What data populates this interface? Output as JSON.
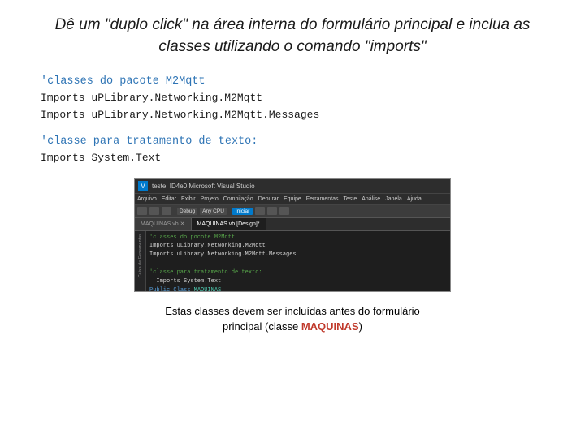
{
  "title": "Dê um \"duplo click\" na área interna do formulário principal e inclua as classes utilizando o comando \"imports\"",
  "sections": [
    {
      "id": "section1",
      "title": "'classes do pacote M2Mqtt",
      "lines": [
        "Imports uPLibrary.Networking.M2Mqtt",
        "Imports uPLibrary.Networking.M2Mqtt.Messages"
      ]
    },
    {
      "id": "section2",
      "title": "'classe para tratamento de texto:",
      "lines": [
        "Imports System.Text"
      ]
    }
  ],
  "vs_window": {
    "title": "teste: ID4e0  Microsoft Visual Studio",
    "menu_items": [
      "Arquivo",
      "Editar",
      "Exibir",
      "Projeto",
      "Compilação",
      "Depurar",
      "Equipe",
      "Ferramentas",
      "Teste",
      "Análise",
      "Janela",
      "Ajuda"
    ],
    "toolbar_debug": "Debug",
    "toolbar_cpu": "Any CPU",
    "toolbar_start": "Iniciar",
    "tabs": [
      {
        "label": "MAQUINAS.vb ✕",
        "active": false
      },
      {
        "label": "MAQUINAS.vb [Design]*",
        "active": true
      }
    ],
    "sidebar_label": "Caixa de Ferramentas",
    "code_lines": [
      {
        "num": "",
        "text": "'classes do pocote M2Mqtt",
        "style": "green"
      },
      {
        "num": "",
        "text": "Imports uLibrary.Networking.M2Mqtt",
        "style": "white"
      },
      {
        "num": "",
        "text": "Imports uLibrary.Networking.M2Mqtt.Messages",
        "style": "white"
      },
      {
        "num": "",
        "text": "",
        "style": "white"
      },
      {
        "num": "",
        "text": "'classe para tratamento de texto:",
        "style": "green"
      },
      {
        "num": "",
        "text": "  Imports System.Text",
        "style": "white"
      },
      {
        "num": "",
        "text": "Public Class MAQUINAS",
        "style": "blue"
      }
    ]
  },
  "bottom_note": {
    "line1": "Estas classes devem ser incluídas antes do formulário",
    "line2_plain": "principal (classe ",
    "line2_highlight": "MAQUINAS",
    "line2_end": ")"
  }
}
